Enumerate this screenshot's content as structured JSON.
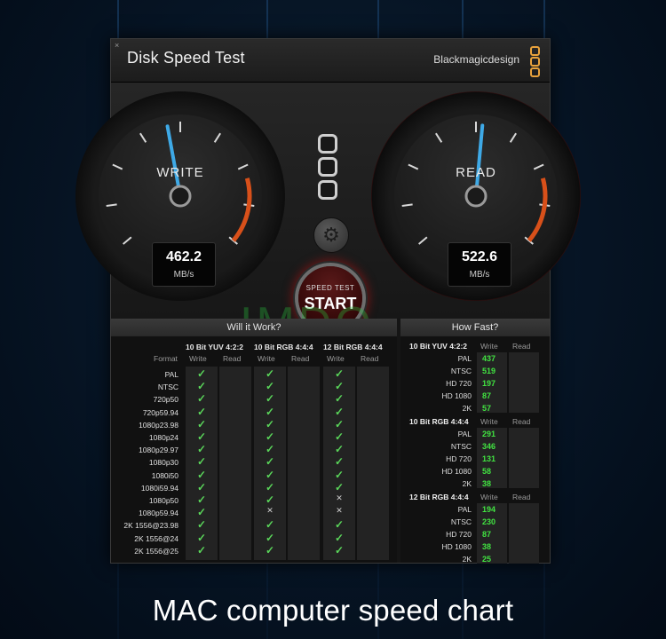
{
  "window": {
    "title": "Disk Speed Test",
    "brand": "Blackmagicdesign"
  },
  "write_gauge": {
    "label": "WRITE",
    "value": "462.2",
    "unit": "MB/s",
    "needle_fraction": 0.46
  },
  "read_gauge": {
    "label": "READ",
    "value": "522.6",
    "unit": "MB/s",
    "needle_fraction": 0.52
  },
  "start_button": {
    "small_label": "SPEED TEST",
    "label": "START"
  },
  "watermark": "IMDO",
  "will_it_work": {
    "title": "Will it Work?",
    "format_header": "Format",
    "groups": [
      "10 Bit YUV 4:2:2",
      "10 Bit RGB 4:4:4",
      "12 Bit RGB 4:4:4"
    ],
    "subheaders": [
      "Write",
      "Read"
    ],
    "rows": [
      {
        "format": "PAL",
        "marks": [
          "check",
          "check",
          "check"
        ]
      },
      {
        "format": "NTSC",
        "marks": [
          "check",
          "check",
          "check"
        ]
      },
      {
        "format": "720p50",
        "marks": [
          "check",
          "check",
          "check"
        ]
      },
      {
        "format": "720p59.94",
        "marks": [
          "check",
          "check",
          "check"
        ]
      },
      {
        "format": "1080p23.98",
        "marks": [
          "check",
          "check",
          "check"
        ]
      },
      {
        "format": "1080p24",
        "marks": [
          "check",
          "check",
          "check"
        ]
      },
      {
        "format": "1080p29.97",
        "marks": [
          "check",
          "check",
          "check"
        ]
      },
      {
        "format": "1080p30",
        "marks": [
          "check",
          "check",
          "check"
        ]
      },
      {
        "format": "1080i50",
        "marks": [
          "check",
          "check",
          "check"
        ]
      },
      {
        "format": "1080i59.94",
        "marks": [
          "check",
          "check",
          "check"
        ]
      },
      {
        "format": "1080p50",
        "marks": [
          "check",
          "check",
          "cross"
        ]
      },
      {
        "format": "1080p59.94",
        "marks": [
          "check",
          "cross",
          "cross"
        ]
      },
      {
        "format": "2K 1556@23.98",
        "marks": [
          "check",
          "check",
          "check"
        ]
      },
      {
        "format": "2K 1556@24",
        "marks": [
          "check",
          "check",
          "check"
        ]
      },
      {
        "format": "2K 1556@25",
        "marks": [
          "check",
          "check",
          "check"
        ]
      }
    ]
  },
  "how_fast": {
    "title": "How Fast?",
    "sections": [
      {
        "name": "10 Bit YUV 4:2:2",
        "write": "Write",
        "read": "Read",
        "rows": [
          {
            "label": "PAL",
            "value": "437"
          },
          {
            "label": "NTSC",
            "value": "519"
          },
          {
            "label": "HD 720",
            "value": "197"
          },
          {
            "label": "HD 1080",
            "value": "87"
          },
          {
            "label": "2K",
            "value": "57"
          }
        ]
      },
      {
        "name": "10 Bit RGB 4:4:4",
        "write": "Write",
        "read": "Read",
        "rows": [
          {
            "label": "PAL",
            "value": "291"
          },
          {
            "label": "NTSC",
            "value": "346"
          },
          {
            "label": "HD 720",
            "value": "131"
          },
          {
            "label": "HD 1080",
            "value": "58"
          },
          {
            "label": "2K",
            "value": "38"
          }
        ]
      },
      {
        "name": "12 Bit RGB 4:4:4",
        "write": "Write",
        "read": "Read",
        "rows": [
          {
            "label": "PAL",
            "value": "194"
          },
          {
            "label": "NTSC",
            "value": "230"
          },
          {
            "label": "HD 720",
            "value": "87"
          },
          {
            "label": "HD 1080",
            "value": "38"
          },
          {
            "label": "2K",
            "value": "25"
          }
        ]
      }
    ]
  },
  "caption": "MAC computer speed chart"
}
